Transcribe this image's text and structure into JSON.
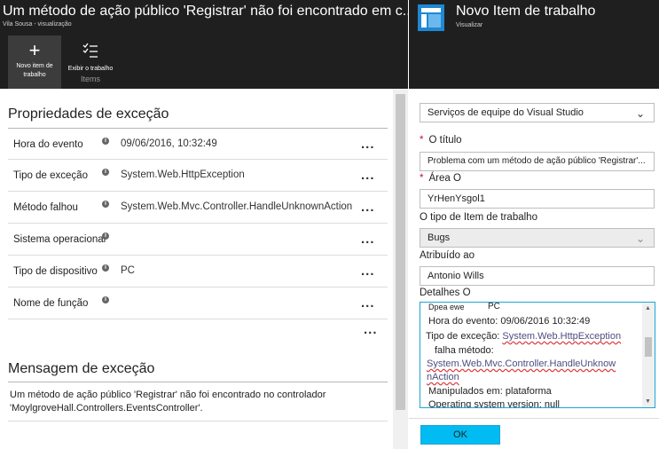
{
  "left_blade": {
    "title": "Um método de ação público 'Registrar' não foi encontrado em c...",
    "subtitle": "Vila Sousa - visualização",
    "commands": {
      "new_item_line1": "Novo item de",
      "new_item_line2": "trabalho",
      "view_items_line1": "Exibir o trabalho",
      "view_items_line2": "Items"
    },
    "exception_properties_title": "Propriedades de exceção",
    "properties": [
      {
        "name": "Hora do evento",
        "value": "09/06/2016, 10:32:49"
      },
      {
        "name": "Tipo de exceção",
        "value": "System.Web.HttpException"
      },
      {
        "name": "Método falhou",
        "value": "System.Web.Mvc.Controller.HandleUnknownAction"
      },
      {
        "name": "Sistema operacional",
        "value": ""
      },
      {
        "name": "Tipo de dispositivo",
        "value": "PC"
      },
      {
        "name": "Nome de função",
        "value": ""
      }
    ],
    "more_label": "...",
    "row_menu_label": "...",
    "exception_message_title": "Mensagem de exceção",
    "exception_message": "Um método de ação público 'Registrar' não foi encontrado no controlador 'MoylgroveHall.Controllers.EventsController'."
  },
  "right_blade": {
    "title": "Novo Item de trabalho",
    "subtitle": "Visualizar",
    "connector_value": "Serviços de equipe do Visual Studio",
    "title_label": "O título",
    "title_value": "Problema com um método de ação público 'Registrar'...",
    "area_label": "Área O",
    "area_value": "YrHenYsgol1",
    "work_item_type_label": "O tipo de Item de trabalho",
    "work_item_type_value": "Bugs",
    "assigned_label": "Atribuído ao",
    "assigned_value": "Antonio Wills",
    "details_label": "Detalhes O",
    "details": {
      "line0_a": "Dpea ewe",
      "line0_b": "PC",
      "line1": "Hora do evento: 09/06/2016 10:32:49",
      "line2_prefix": "Tipo de exceção: ",
      "line2_link": "System.Web.HttpException",
      "line3": "falha método:",
      "line4": "System.Web.Mvc.Controller.HandleUnknow",
      "line5": "nAction",
      "line6": "Manipulados em: plataforma",
      "line7": "Operating system version: null"
    },
    "ok_label": "OK",
    "chevron_glyph": "⌄",
    "icons": {
      "connector": "chevron-down-icon",
      "work_item_type": "chevron-down-icon",
      "blade": "work-item-blade-icon"
    }
  }
}
